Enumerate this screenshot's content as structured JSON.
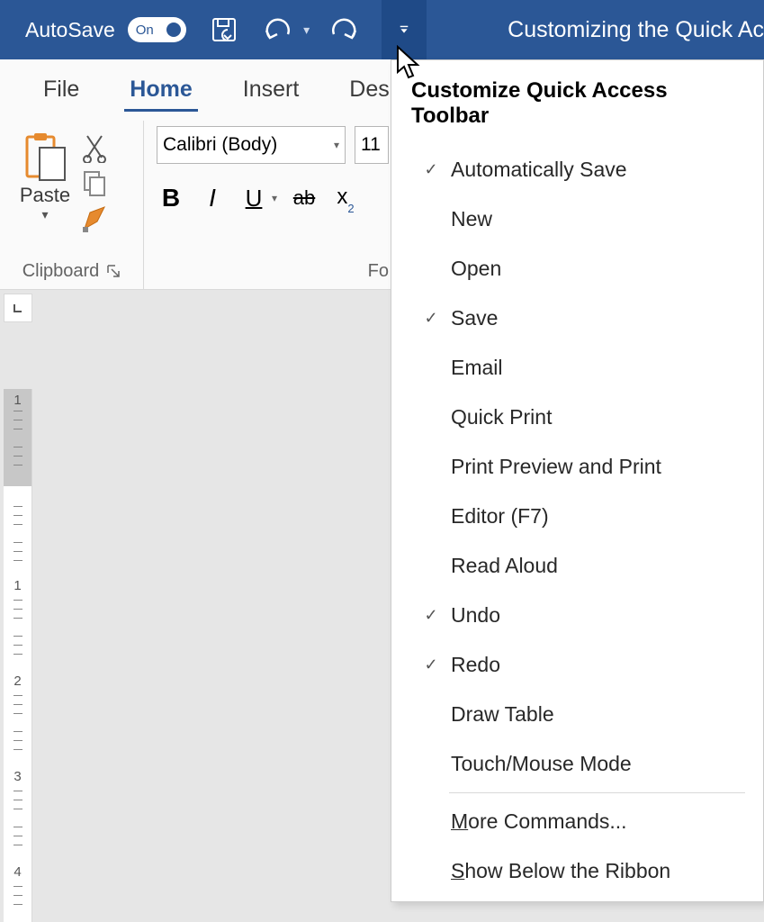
{
  "titlebar": {
    "autosave_label": "AutoSave",
    "toggle_text": "On",
    "doc_title": "Customizing the Quick Ac"
  },
  "tabs": {
    "file": "File",
    "home": "Home",
    "insert": "Insert",
    "design": "Desi"
  },
  "clipboard": {
    "paste_label": "Paste",
    "group_label": "Clipboard"
  },
  "font": {
    "font_name": "Calibri (Body)",
    "font_size": "11",
    "bold": "B",
    "italic": "I",
    "underline": "U",
    "strike": "ab",
    "subscript_x": "x",
    "subscript_2": "2",
    "group_label": "Fo"
  },
  "dropdown": {
    "title": "Customize Quick Access Toolbar",
    "items": [
      {
        "label": "Automatically Save",
        "checked": true
      },
      {
        "label": "New",
        "checked": false
      },
      {
        "label": "Open",
        "checked": false
      },
      {
        "label": "Save",
        "checked": true
      },
      {
        "label": "Email",
        "checked": false
      },
      {
        "label": "Quick Print",
        "checked": false
      },
      {
        "label": "Print Preview and Print",
        "checked": false
      },
      {
        "label": "Editor (F7)",
        "checked": false
      },
      {
        "label": "Read Aloud",
        "checked": false
      },
      {
        "label": "Undo",
        "checked": true
      },
      {
        "label": "Redo",
        "checked": true
      },
      {
        "label": "Draw Table",
        "checked": false
      },
      {
        "label": "Touch/Mouse Mode",
        "checked": false
      }
    ],
    "more_pre": "M",
    "more_rest": "ore Commands...",
    "below_pre": "S",
    "below_rest": "how Below the Ribbon"
  },
  "ruler": {
    "n1": "1",
    "n2": "2",
    "n3": "3",
    "n4": "4",
    "top_neg": "1"
  }
}
